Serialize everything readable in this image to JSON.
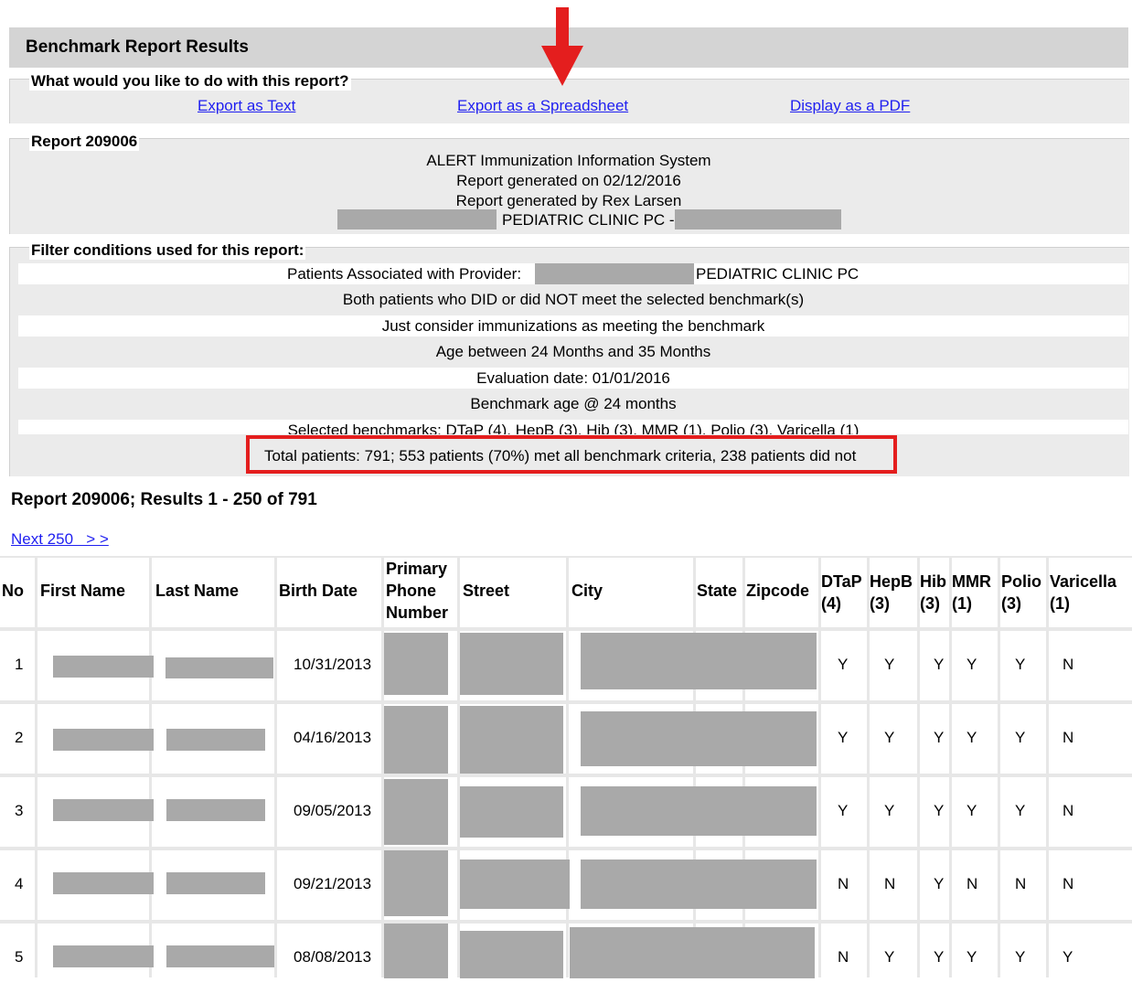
{
  "report": {
    "title": "Benchmark Report Results",
    "actions_heading": "What would you like to do with this report?",
    "actions": [
      "Export as Text",
      "Export as a Spreadsheet",
      "Display as a PDF"
    ],
    "report_heading": "Report 209006",
    "info_lines": [
      "ALERT Immunization Information System",
      "Report generated on 02/12/2016",
      "Report generated by Rex Larsen"
    ],
    "clinic_line": "PEDIATRIC CLINIC PC -",
    "filter_heading": "Filter conditions used for this report:",
    "filter_provider_label": "Patients Associated with Provider:",
    "filter_provider_clinic": "PEDIATRIC CLINIC PC",
    "filters": [
      "Both patients who DID or did NOT meet the selected benchmark(s)",
      "Just consider immunizations as meeting the benchmark",
      "Age between 24 Months and 35 Months",
      "Evaluation date: 01/01/2016",
      "Benchmark age @ 24 months",
      "Selected benchmarks: DTaP (4), HepB (3), Hib (3), MMR (1), Polio (3), Varicella (1)"
    ],
    "summary": "Total patients: 791; 553 patients (70%) met all benchmark criteria, 238 patients did not",
    "results_title": "Report 209006; Results 1 - 250 of 791",
    "next_link": "Next 250   > >"
  },
  "table": {
    "headers": {
      "no": "No",
      "first_name": "First Name",
      "last_name": "Last Name",
      "birth_date": "Birth Date",
      "phone_1": "Primary",
      "phone_2": "Phone",
      "phone_3": "Number",
      "street": "Street",
      "city": "City",
      "state": "State",
      "zipcode": "Zipcode",
      "dtap_1": "DTaP",
      "dtap_2": "(4)",
      "hepb_1": "HepB",
      "hepb_2": "(3)",
      "hib_1": "Hib",
      "hib_2": "(3)",
      "mmr_1": "MMR",
      "mmr_2": "(1)",
      "polio_1": "Polio",
      "polio_2": "(3)",
      "varicella_1": "Varicella",
      "varicella_2": "(1)"
    },
    "rows": [
      {
        "no": "1",
        "birth_date": "10/31/2013",
        "dtap": "Y",
        "hepb": "Y",
        "hib": "Y",
        "mmr": "Y",
        "polio": "Y",
        "varicella": "N"
      },
      {
        "no": "2",
        "birth_date": "04/16/2013",
        "dtap": "Y",
        "hepb": "Y",
        "hib": "Y",
        "mmr": "Y",
        "polio": "Y",
        "varicella": "N"
      },
      {
        "no": "3",
        "birth_date": "09/05/2013",
        "dtap": "Y",
        "hepb": "Y",
        "hib": "Y",
        "mmr": "Y",
        "polio": "Y",
        "varicella": "N"
      },
      {
        "no": "4",
        "birth_date": "09/21/2013",
        "dtap": "N",
        "hepb": "N",
        "hib": "Y",
        "mmr": "N",
        "polio": "N",
        "varicella": "N"
      },
      {
        "no": "5",
        "birth_date": "08/08/2013",
        "dtap": "N",
        "hepb": "Y",
        "hib": "Y",
        "mmr": "Y",
        "polio": "Y",
        "varicella": "Y"
      }
    ]
  },
  "colors": {
    "annotation_red": "#e41e1e",
    "link_blue": "#1f1ff0",
    "redaction_grey": "#a9a9a9"
  }
}
